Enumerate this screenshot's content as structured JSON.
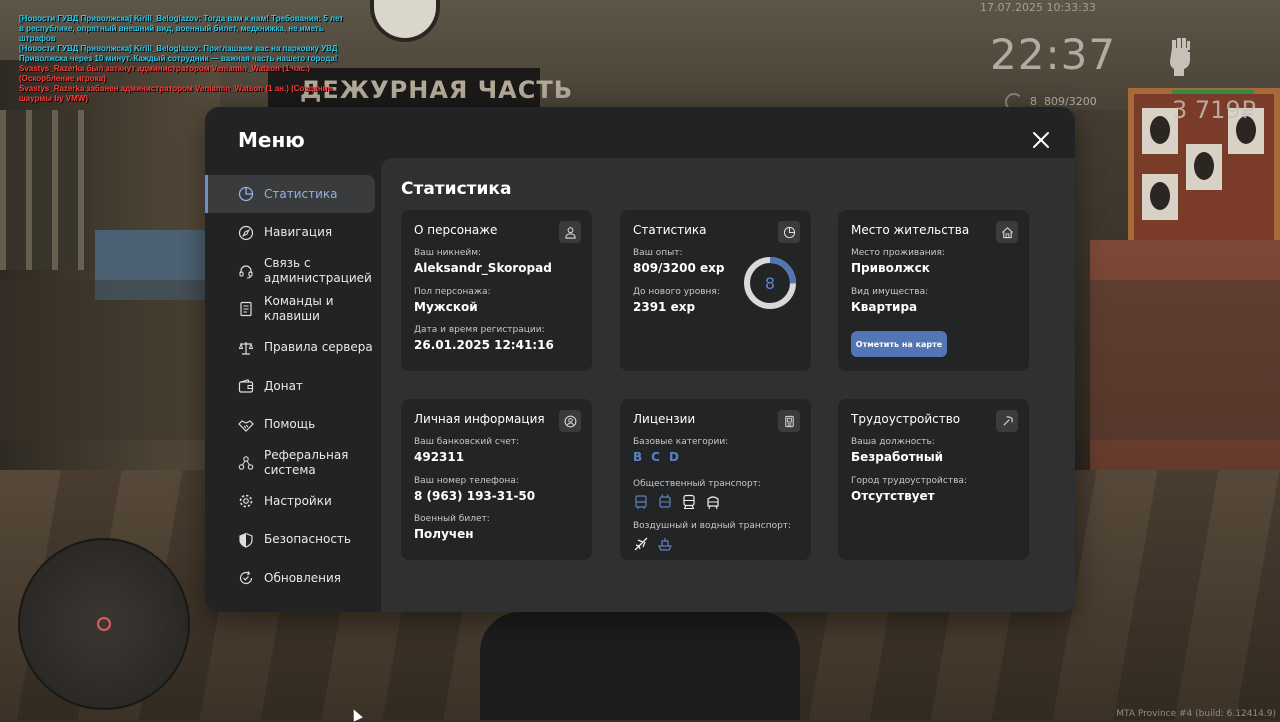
{
  "chat": [
    {
      "color": "cyan",
      "text": "[Новости ГУВД Приволжска] Kirill_Beloglazov: Тогда вам к нам! Требования: 5 лет в республике, опрятный внешний вид, военный билет, медкнижка, не иметь штрафов"
    },
    {
      "color": "cyan",
      "text": "[Новости ГУВД Приволжска] Kirill_Beloglazov: Приглашаем вас на парковку УВД Приволжска через 10 минут. Каждый сотрудник — важная часть нашего города!"
    },
    {
      "color": "red",
      "text": "Svastys_Razerka был заткнут администратором Veniamin_Watson (1 час.) (Оскорбление игрока)"
    },
    {
      "color": "red",
      "text": "Svastys_Razerka забанен администратором Veniamin_Watson (1 ан.) (Создание шаурмы by VMW)"
    }
  ],
  "hud": {
    "date": "17.07.2025 10:33:33",
    "time": "22:37",
    "level": "8",
    "exp": "809/3200",
    "money": "3 719₽",
    "build": "MTA Province #4 (build: 6.12414.9)"
  },
  "scene": {
    "sign": "ДЕЖУРНАЯ ЧАСТЬ"
  },
  "menu": {
    "title": "Меню",
    "sidebar": [
      {
        "label": "Статистика",
        "icon": "pie-chart-icon",
        "active": true
      },
      {
        "label": "Навигация",
        "icon": "compass-icon"
      },
      {
        "label": "Связь с\nадминистрацией",
        "icon": "headset-icon"
      },
      {
        "label": "Команды и\nклавиши",
        "icon": "document-icon"
      },
      {
        "label": "Правила сервера",
        "icon": "scales-icon"
      },
      {
        "label": "Донат",
        "icon": "wallet-icon"
      },
      {
        "label": "Помощь",
        "icon": "handshake-icon"
      },
      {
        "label": "Реферальная\nсистема",
        "icon": "network-icon"
      },
      {
        "label": "Настройки",
        "icon": "gear-icon"
      },
      {
        "label": "Безопасность",
        "icon": "shield-icon"
      },
      {
        "label": "Обновления",
        "icon": "refresh-check-icon"
      }
    ],
    "content_title": "Статистика",
    "cards": {
      "character": {
        "title": "О персонаже",
        "nick_label": "Ваш никнейм:",
        "nick": "Aleksandr_Skoropad",
        "gender_label": "Пол персонажа:",
        "gender": "Мужской",
        "reg_label": "Дата и время регистрации:",
        "reg": "26.01.2025 12:41:16"
      },
      "stats": {
        "title": "Статистика",
        "exp_label": "Ваш опыт:",
        "exp": "809/3200 exp",
        "next_label": "До нового уровня:",
        "next": "2391 exp",
        "level": "8",
        "progress": 0.2528
      },
      "residence": {
        "title": "Место жительства",
        "place_label": "Место проживания:",
        "place": "Приволжск",
        "property_label": "Вид имущества:",
        "property": "Квартира",
        "button": "Отметить на карте"
      },
      "personal": {
        "title": "Личная информация",
        "bank_label": "Ваш банковский счет:",
        "bank": "492311",
        "phone_label": "Ваш номер телефона:",
        "phone": "8 (963) 193-31-50",
        "military_label": "Военный билет:",
        "military": "Получен"
      },
      "licenses": {
        "title": "Лицензии",
        "base_label": "Базовые категории:",
        "categories": [
          "B",
          "C",
          "D"
        ],
        "public_label": "Общественный транспорт:",
        "public_icons": [
          "bus-icon",
          "trolleybus-icon",
          "train-icon",
          "tram-icon"
        ],
        "air_label": "Воздушный и водный транспорт:",
        "air_icons": [
          "plane-icon",
          "boat-icon"
        ]
      },
      "employment": {
        "title": "Трудоустройство",
        "position_label": "Ваша должность:",
        "position": "Безработный",
        "city_label": "Город трудоустройства:",
        "city": "Отсутствует"
      }
    }
  },
  "colors": {
    "accent": "#5276b3",
    "active_text": "#8fb2e6",
    "license_blue": "#5a82c4"
  }
}
